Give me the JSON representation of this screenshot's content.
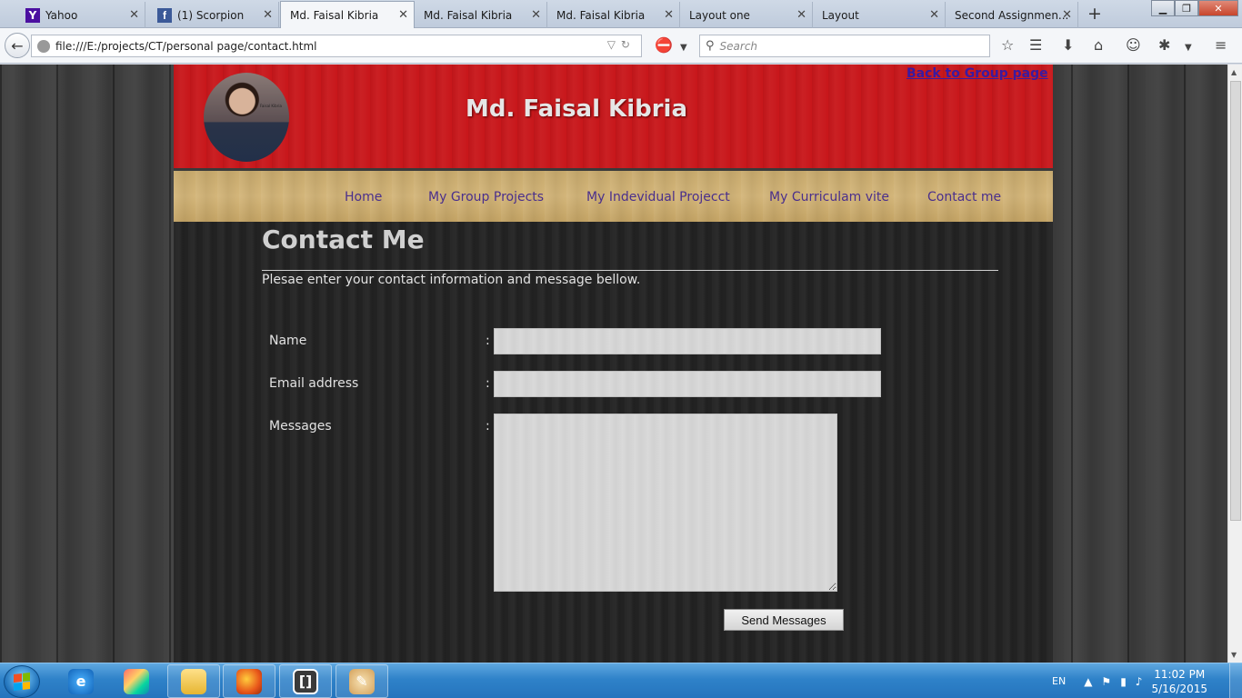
{
  "browser": {
    "tabs": [
      {
        "label": "Yahoo",
        "icon": "yahoo-icon",
        "active": false
      },
      {
        "label": "(1) Scorpion",
        "icon": "facebook-icon",
        "active": false
      },
      {
        "label": "Md. Faisal Kibria",
        "icon": "",
        "active": true
      },
      {
        "label": "Md. Faisal Kibria",
        "icon": "",
        "active": false
      },
      {
        "label": "Md. Faisal Kibria",
        "icon": "",
        "active": false
      },
      {
        "label": "Layout one",
        "icon": "",
        "active": false
      },
      {
        "label": "Layout",
        "icon": "",
        "active": false
      },
      {
        "label": "Second Assignmen...",
        "icon": "",
        "active": false
      }
    ],
    "url": "file:///E:/projects/CT/personal page/contact.html",
    "search_placeholder": "Search"
  },
  "site": {
    "title": "Md. Faisal Kibria",
    "back_link": "Back to Group page",
    "avatar_caption": "Faisal Kibria",
    "menu": [
      "Home",
      "My Group Projects",
      "My Indevidual Projecct",
      "My Curriculam vite",
      "Contact me"
    ]
  },
  "contact": {
    "heading": "Contact Me",
    "intro": "Plesae enter your contact information and message bellow.",
    "fields": {
      "name_label": "Name",
      "email_label": "Email address",
      "messages_label": "Messages",
      "colon": ":"
    },
    "name_value": "",
    "email_value": "",
    "messages_value": "",
    "send_label": "Send Messages"
  },
  "taskbar": {
    "language": "EN",
    "time": "11:02 PM",
    "date": "5/16/2015"
  },
  "colors": {
    "header_red": "#c8171b",
    "menu_gold": "#d4b67a",
    "link_purple": "#4a2f8c"
  }
}
